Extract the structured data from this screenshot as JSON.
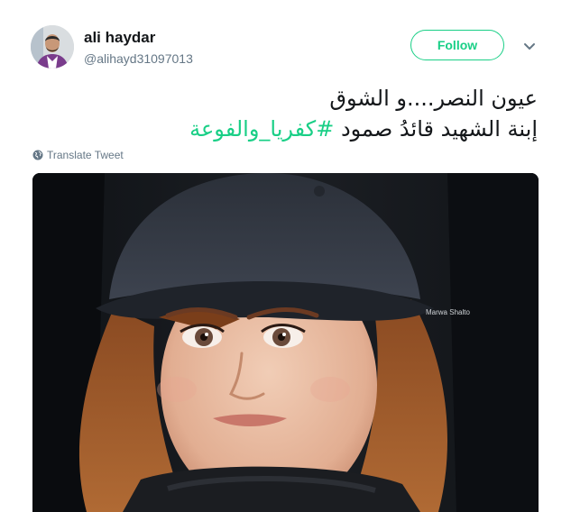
{
  "tweet": {
    "author": {
      "name": "ali haydar",
      "handle": "@alihayd31097013",
      "avatar_icon": "person-avatar-icon"
    },
    "follow_label": "Follow",
    "menu_icon": "chevron-down-icon",
    "text_lines": [
      "عيون النصر....و الشوق",
      "إبنة الشهيد قائدُ صمود "
    ],
    "hashtag": "#كفريا_والفوعة",
    "translate_label": "Translate Tweet",
    "translate_icon": "globe-icon",
    "media": {
      "watermark": "Marwa Shalto"
    }
  },
  "colors": {
    "accent": "#19cf86",
    "text": "#14171a",
    "muted": "#657786"
  }
}
